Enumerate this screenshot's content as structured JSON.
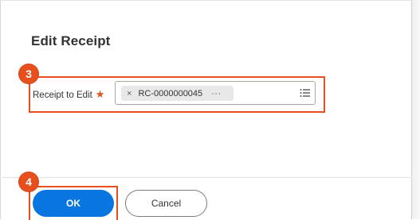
{
  "dialog": {
    "title": "Edit Receipt"
  },
  "annotations": {
    "step_3": "3",
    "step_4": "4",
    "highlight_color": "#e7501e"
  },
  "field": {
    "label": "Receipt to Edit",
    "required_marker": "★",
    "remove_icon": "×",
    "selected_value": "RC-0000000045",
    "more_icon": "···",
    "list_icon": "list-icon"
  },
  "footer": {
    "ok_label": "OK",
    "cancel_label": "Cancel",
    "primary_color": "#0875e1"
  }
}
